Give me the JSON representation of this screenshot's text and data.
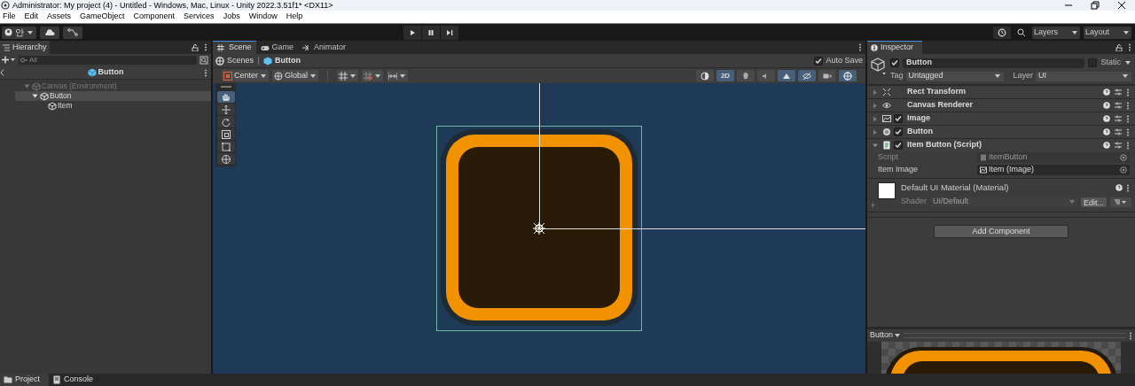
{
  "window": {
    "title": "Administrator: My project (4) - Untitled - Windows, Mac, Linux - Unity 2022.3.51f1* <DX11>"
  },
  "menu": [
    "File",
    "Edit",
    "Assets",
    "GameObject",
    "Component",
    "Services",
    "Jobs",
    "Window",
    "Help"
  ],
  "toolbar": {
    "account": "안",
    "layers": "Layers",
    "layout": "Layout"
  },
  "hierarchy": {
    "tab": "Hierarchy",
    "search": {
      "placeholder": "All"
    },
    "header": "Button",
    "tree": [
      {
        "label": "Canvas (Environment)",
        "expanded": true,
        "selected": false,
        "dim": true,
        "children": [
          {
            "label": "Button",
            "expanded": true,
            "selected": true,
            "dim": false,
            "children": [
              {
                "label": "Item",
                "selected": false,
                "dim": false
              }
            ]
          }
        ]
      }
    ]
  },
  "scene": {
    "tabs": [
      {
        "label": "Scene",
        "selected": true
      },
      {
        "label": "Game",
        "selected": false
      },
      {
        "label": "Animator",
        "selected": false
      }
    ],
    "breadcrumb": [
      "Scenes",
      "Button"
    ],
    "auto_save": {
      "label": "Auto Save",
      "checked": true
    },
    "pivot": "Center",
    "space": "Global",
    "mode_2d": {
      "label": "2D",
      "on": true
    },
    "tools": [
      {
        "kind": "hand",
        "selected": true
      },
      {
        "kind": "move",
        "selected": false
      },
      {
        "kind": "rotate",
        "selected": false
      },
      {
        "kind": "scale",
        "selected": false
      },
      {
        "kind": "rect",
        "selected": false
      },
      {
        "kind": "transform",
        "selected": false
      }
    ]
  },
  "inspector": {
    "tab": "Inspector",
    "name": "Button",
    "active": true,
    "static": {
      "label": "Static",
      "checked": false
    },
    "tag": {
      "label": "Tag",
      "value": "Untagged"
    },
    "layer": {
      "label": "Layer",
      "value": "UI"
    },
    "components": [
      {
        "name": "Rect Transform",
        "kind": "rect",
        "expanded": false
      },
      {
        "name": "Canvas Renderer",
        "kind": "eye",
        "expanded": false
      },
      {
        "name": "Image",
        "kind": "image",
        "expanded": false,
        "enabled": true
      },
      {
        "name": "Button",
        "kind": "button",
        "expanded": false,
        "enabled": true
      },
      {
        "name": "Item Button (Script)",
        "kind": "script",
        "expanded": true,
        "enabled": true
      }
    ],
    "properties": [
      {
        "label": "Script",
        "value": "ItemButton",
        "disabled": true
      },
      {
        "label": "Item Image",
        "value": "Item (Image)",
        "disabled": false
      }
    ],
    "material": {
      "name": "Default UI Material (Material)",
      "shader_label": "Shader",
      "shader": "UI/Default",
      "edit": "Edit..."
    },
    "add_component": "Add Component",
    "preview": "Button"
  },
  "bottom_tabs": [
    {
      "label": "Project",
      "selected": true
    },
    {
      "label": "Console",
      "selected": false
    }
  ]
}
